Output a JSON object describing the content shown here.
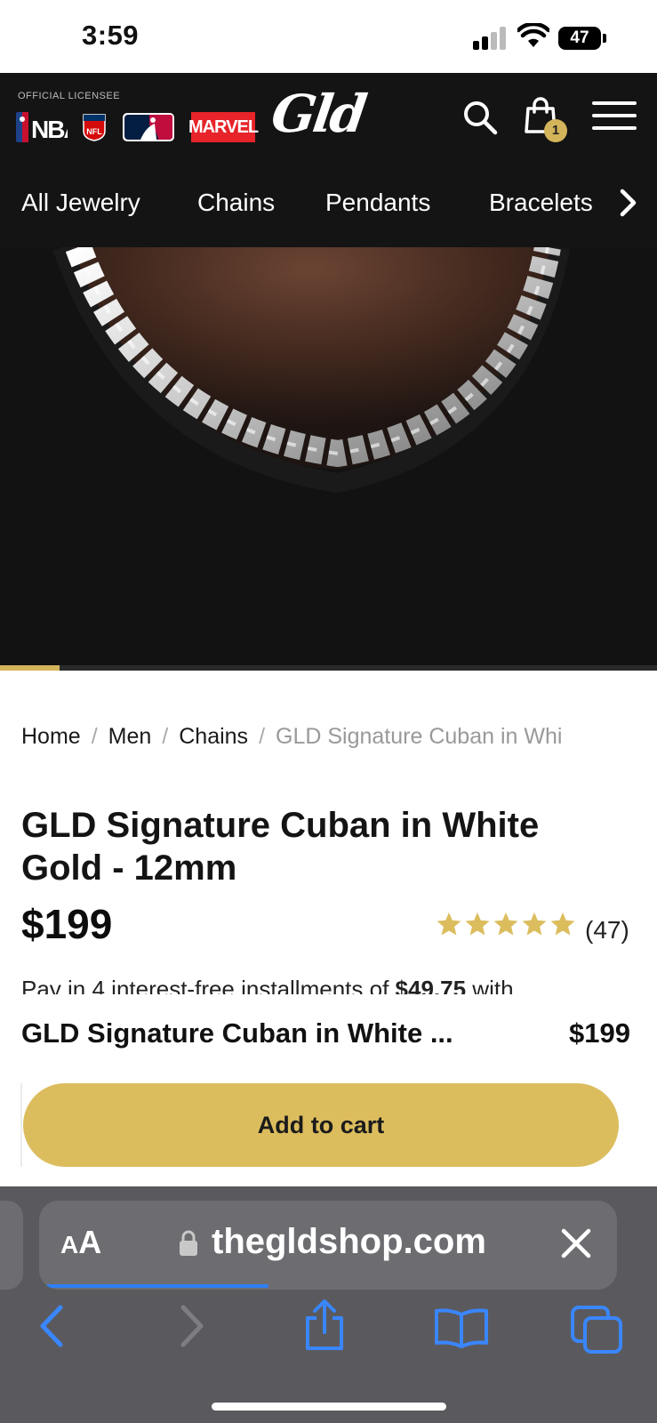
{
  "status": {
    "time": "3:59",
    "battery": "47"
  },
  "header": {
    "licensee": "OFFICIAL LICENSEE",
    "leagues": {
      "nba": "NBA",
      "nfl": "NFL",
      "marvel": "MARVEL"
    },
    "logo": "Gld",
    "cart_count": "1"
  },
  "categories": [
    "All Jewelry",
    "Chains",
    "Pendants",
    "Bracelets"
  ],
  "gallery": {
    "progress_fraction": 0.09
  },
  "breadcrumb": {
    "home": "Home",
    "men": "Men",
    "chains": "Chains",
    "current": "GLD Signature Cuban in Whi"
  },
  "product": {
    "title": "GLD Signature Cuban in White Gold - 12mm",
    "price": "$199",
    "rating": 5,
    "review_count": "(47)",
    "installments_prefix": "Pay in 4 interest-free installments of ",
    "installments_amount": "$49.75",
    "installments_suffix": " with"
  },
  "sticky_bar": {
    "name": "GLD Signature Cuban in White ...",
    "price": "$199",
    "add_to_cart": "Add to cart"
  },
  "browser": {
    "aa_small": "A",
    "aa_large": "A",
    "domain": "thegldshop.com"
  },
  "colors": {
    "accent": "#dcbd5e",
    "header_bg": "#141414",
    "link_blue": "#2f7ff5"
  }
}
